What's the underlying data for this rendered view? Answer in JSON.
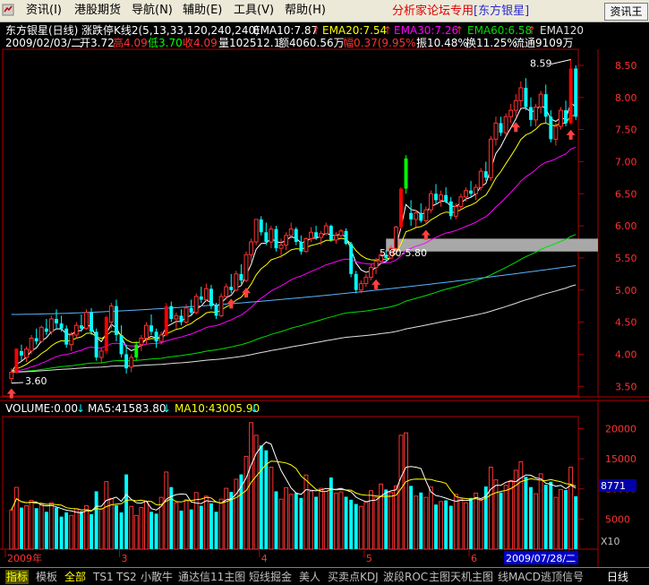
{
  "menubar": {
    "items": [
      "资讯(I)",
      "港股期货",
      "导航(N)",
      "辅助(E)",
      "工具(V)",
      "帮助(H)"
    ],
    "banner_prefix": "分析家论坛专用",
    "banner_stock": "[东方银星]",
    "quote_button": "资讯王"
  },
  "chart_header": {
    "line1": {
      "title": "东方银星(日线)",
      "formula": "涨跌停K线2(5,13,33,120,240,240)",
      "ema10": "EMA10:7.87",
      "ema20": "EMA20:7.54",
      "ema30": "EMA30:7.26",
      "ema60": "EMA60:6.58",
      "ema120": "EMA120"
    },
    "line2": {
      "date": "2009/02/03/二",
      "open": "开3.72",
      "high": "高4.09",
      "low": "低3.70",
      "close": "收4.09",
      "volume": "量102512.1",
      "amount": "额4060.56万",
      "change": "幅0.37(9.95%)",
      "amplitude": "振10.48%",
      "turnover": "换11.25%",
      "float": "流通9109万"
    }
  },
  "colors": {
    "up": "#ff3232",
    "down": "#00ffff",
    "limit_up_red": "#ff0000",
    "limit_up_green": "#00ff00",
    "ema10": "#ffffff",
    "ema20": "#ffff00",
    "ema30": "#ff00ff",
    "ema60": "#00e000",
    "ema120": "#e0e0e0",
    "ema240": "#5ab4ff",
    "axis": "#b00000",
    "arrow": "#ff4040"
  },
  "chart_data": [
    {
      "type": "candlestick",
      "title": "东方银星(日线)",
      "price_axis_ticks": [
        3.5,
        4.0,
        4.5,
        5.0,
        5.5,
        6.0,
        6.5,
        7.0,
        7.5,
        8.0,
        8.5
      ],
      "ylim": [
        3.35,
        8.75
      ],
      "x_month_labels": [
        "2009年",
        "3",
        "4",
        "5",
        "6",
        "7"
      ],
      "annotations": {
        "high_label": "8.59",
        "low_label": "3.60",
        "zone_label": "5.60-5.80"
      },
      "zone": [
        5.6,
        5.8
      ],
      "ohlc": [
        [
          3.62,
          3.78,
          3.55,
          3.72
        ],
        [
          3.72,
          4.09,
          3.7,
          4.09
        ],
        [
          4.05,
          4.15,
          3.9,
          3.98
        ],
        [
          3.95,
          4.12,
          3.88,
          4.08
        ],
        [
          4.05,
          4.3,
          4.0,
          4.25
        ],
        [
          4.25,
          4.4,
          4.15,
          4.2
        ],
        [
          4.2,
          4.45,
          4.18,
          4.42
        ],
        [
          4.4,
          4.55,
          4.3,
          4.35
        ],
        [
          4.35,
          4.6,
          4.3,
          4.55
        ],
        [
          4.55,
          4.7,
          4.4,
          4.48
        ],
        [
          4.48,
          4.6,
          4.35,
          4.4
        ],
        [
          4.4,
          4.45,
          4.1,
          4.15
        ],
        [
          4.15,
          4.35,
          4.05,
          4.3
        ],
        [
          4.3,
          4.5,
          4.25,
          4.45
        ],
        [
          4.45,
          4.62,
          4.35,
          4.4
        ],
        [
          4.4,
          4.7,
          4.38,
          4.65
        ],
        [
          4.65,
          4.72,
          4.3,
          4.35
        ],
        [
          4.35,
          4.4,
          3.9,
          3.95
        ],
        [
          3.95,
          4.1,
          3.85,
          4.05
        ],
        [
          4.05,
          4.6,
          4.0,
          4.58
        ],
        [
          4.5,
          4.8,
          4.4,
          4.75
        ],
        [
          4.75,
          4.85,
          4.2,
          4.3
        ],
        [
          4.3,
          4.45,
          3.95,
          4.0
        ],
        [
          4.0,
          4.15,
          3.7,
          3.78
        ],
        [
          3.8,
          4.0,
          3.72,
          3.95
        ],
        [
          3.95,
          4.2,
          3.9,
          4.15
        ],
        [
          4.15,
          4.3,
          4.05,
          4.25
        ],
        [
          4.25,
          4.5,
          4.15,
          4.45
        ],
        [
          4.45,
          4.62,
          4.3,
          4.35
        ],
        [
          4.35,
          4.4,
          4.1,
          4.2
        ],
        [
          4.2,
          4.35,
          4.15,
          4.3
        ],
        [
          4.3,
          4.8,
          4.28,
          4.75
        ],
        [
          4.75,
          4.82,
          4.5,
          4.55
        ],
        [
          4.55,
          4.65,
          4.4,
          4.6
        ],
        [
          4.6,
          4.7,
          4.45,
          4.5
        ],
        [
          4.5,
          4.78,
          4.48,
          4.72
        ],
        [
          4.72,
          4.85,
          4.6,
          4.65
        ],
        [
          4.65,
          4.95,
          4.62,
          4.9
        ],
        [
          4.9,
          5.05,
          4.8,
          4.85
        ],
        [
          4.85,
          5.1,
          4.82,
          5.02
        ],
        [
          5.02,
          5.08,
          4.7,
          4.75
        ],
        [
          4.75,
          4.8,
          4.55,
          4.6
        ],
        [
          4.6,
          4.95,
          4.58,
          4.9
        ],
        [
          4.9,
          5.1,
          4.85,
          5.05
        ],
        [
          5.05,
          5.25,
          4.95,
          5.0
        ],
        [
          5.0,
          5.3,
          4.98,
          5.25
        ],
        [
          5.25,
          5.4,
          5.1,
          5.15
        ],
        [
          5.15,
          5.6,
          5.12,
          5.55
        ],
        [
          5.55,
          5.8,
          5.45,
          5.75
        ],
        [
          5.75,
          6.1,
          5.7,
          6.1
        ],
        [
          6.1,
          6.15,
          5.85,
          5.9
        ],
        [
          5.9,
          6.05,
          5.7,
          5.75
        ],
        [
          5.75,
          6.0,
          5.65,
          5.95
        ],
        [
          5.95,
          6.0,
          5.6,
          5.65
        ],
        [
          5.65,
          5.8,
          5.5,
          5.7
        ],
        [
          5.7,
          5.9,
          5.62,
          5.85
        ],
        [
          5.85,
          6.05,
          5.8,
          5.95
        ],
        [
          5.95,
          5.98,
          5.7,
          5.75
        ],
        [
          5.75,
          5.85,
          5.55,
          5.6
        ],
        [
          5.6,
          5.82,
          5.58,
          5.8
        ],
        [
          5.8,
          5.98,
          5.75,
          5.9
        ],
        [
          5.9,
          6.0,
          5.78,
          5.82
        ],
        [
          5.82,
          5.92,
          5.7,
          5.88
        ],
        [
          5.88,
          6.05,
          5.85,
          6.0
        ],
        [
          6.0,
          6.02,
          5.75,
          5.78
        ],
        [
          5.78,
          5.9,
          5.72,
          5.85
        ],
        [
          5.85,
          5.95,
          5.8,
          5.92
        ],
        [
          5.92,
          5.96,
          5.7,
          5.72
        ],
        [
          5.72,
          5.75,
          5.2,
          5.25
        ],
        [
          5.25,
          5.3,
          4.95,
          5.0
        ],
        [
          5.0,
          5.15,
          4.95,
          5.1
        ],
        [
          5.1,
          5.25,
          5.05,
          5.2
        ],
        [
          5.2,
          5.4,
          5.15,
          5.35
        ],
        [
          5.35,
          5.5,
          5.25,
          5.45
        ],
        [
          5.45,
          5.6,
          5.4,
          5.55
        ],
        [
          5.55,
          5.62,
          5.45,
          5.5
        ],
        [
          5.5,
          5.7,
          5.48,
          5.65
        ],
        [
          5.65,
          6.0,
          5.6,
          5.98
        ],
        [
          5.98,
          6.6,
          5.95,
          6.58
        ],
        [
          6.58,
          7.1,
          6.5,
          7.05
        ],
        [
          6.2,
          6.4,
          6.0,
          6.1
        ],
        [
          6.1,
          6.25,
          5.98,
          6.2
        ],
        [
          6.2,
          6.35,
          6.05,
          6.08
        ],
        [
          6.08,
          6.3,
          6.02,
          6.25
        ],
        [
          6.25,
          6.55,
          6.2,
          6.5
        ],
        [
          6.5,
          6.65,
          6.35,
          6.4
        ],
        [
          6.4,
          6.55,
          6.3,
          6.48
        ],
        [
          6.48,
          6.6,
          6.35,
          6.38
        ],
        [
          6.38,
          6.45,
          6.1,
          6.15
        ],
        [
          6.15,
          6.35,
          6.1,
          6.3
        ],
        [
          6.3,
          6.5,
          6.25,
          6.45
        ],
        [
          6.45,
          6.6,
          6.38,
          6.55
        ],
        [
          6.55,
          6.7,
          6.45,
          6.5
        ],
        [
          6.5,
          6.65,
          6.4,
          6.6
        ],
        [
          6.6,
          6.9,
          6.55,
          6.85
        ],
        [
          6.85,
          7.0,
          6.7,
          6.75
        ],
        [
          6.75,
          7.4,
          6.7,
          7.35
        ],
        [
          7.35,
          7.7,
          7.25,
          7.6
        ],
        [
          7.6,
          7.7,
          7.4,
          7.45
        ],
        [
          7.45,
          7.75,
          7.4,
          7.7
        ],
        [
          7.7,
          7.9,
          7.6,
          7.8
        ],
        [
          7.8,
          8.05,
          7.7,
          7.95
        ],
        [
          7.95,
          8.25,
          7.85,
          8.15
        ],
        [
          8.15,
          8.3,
          7.8,
          7.85
        ],
        [
          7.85,
          8.0,
          7.55,
          7.65
        ],
        [
          7.65,
          7.9,
          7.55,
          7.85
        ],
        [
          7.85,
          8.1,
          7.75,
          8.05
        ],
        [
          8.05,
          8.2,
          7.6,
          7.7
        ],
        [
          7.7,
          7.8,
          7.3,
          7.35
        ],
        [
          7.35,
          7.6,
          7.25,
          7.55
        ],
        [
          7.55,
          7.85,
          7.5,
          7.8
        ],
        [
          7.8,
          7.95,
          7.55,
          7.6
        ],
        [
          7.6,
          8.59,
          7.58,
          8.45
        ],
        [
          8.45,
          8.5,
          7.65,
          7.7
        ]
      ]
    },
    {
      "type": "bar",
      "title": "VOLUME",
      "header": {
        "volume": "VOLUME:0.00",
        "ma5": "MA5:41583.80",
        "ma10": "MA10:43005.90"
      },
      "volume_axis_ticks": [
        5000,
        10000,
        15000,
        20000
      ],
      "ylim": [
        0,
        22000
      ],
      "scale_label": "X10",
      "current_value_label": "8771",
      "date_label": "2009/07/28/二",
      "period_label": "日线",
      "values": [
        6500,
        10250,
        6900,
        7200,
        8100,
        6800,
        7500,
        6200,
        7700,
        6900,
        5400,
        6100,
        5600,
        6700,
        6300,
        7200,
        5800,
        9600,
        6700,
        11200,
        8400,
        7300,
        6100,
        12400,
        7100,
        5600,
        6900,
        7900,
        6200,
        5900,
        8600,
        12800,
        10300,
        7700,
        6400,
        8200,
        6600,
        9400,
        7200,
        8800,
        7600,
        6200,
        8300,
        10100,
        9500,
        11600,
        12400,
        15400,
        21000,
        18900,
        17200,
        16400,
        13600,
        9600,
        8300,
        10200,
        9100,
        9300,
        8500,
        12300,
        9600,
        8700,
        10100,
        9600,
        11900,
        9300,
        9500,
        8700,
        8200,
        7500,
        7100,
        7800,
        9700,
        8600,
        10800,
        9900,
        9400,
        10500,
        18900,
        19300,
        10500,
        8800,
        9400,
        8600,
        10300,
        7400,
        7900,
        8100,
        7200,
        9100,
        8300,
        7700,
        8500,
        9300,
        8100,
        10400,
        13600,
        11500,
        9400,
        10600,
        11400,
        13100,
        14500,
        12000,
        10300,
        9200,
        12500,
        10700,
        11200,
        8600,
        9900,
        9800,
        13600,
        8771
      ]
    }
  ],
  "bottom_tabs": {
    "items": [
      "指标",
      "模板",
      "全部",
      "TS1",
      "TS2",
      "小散牛",
      "通达信11主图",
      "短线掘金",
      "美人",
      "买卖点KDJ",
      "波段ROC",
      "主图天机主图",
      "线MACD",
      "逃顶信号"
    ],
    "active_index": 2,
    "highlight_index": 0
  }
}
